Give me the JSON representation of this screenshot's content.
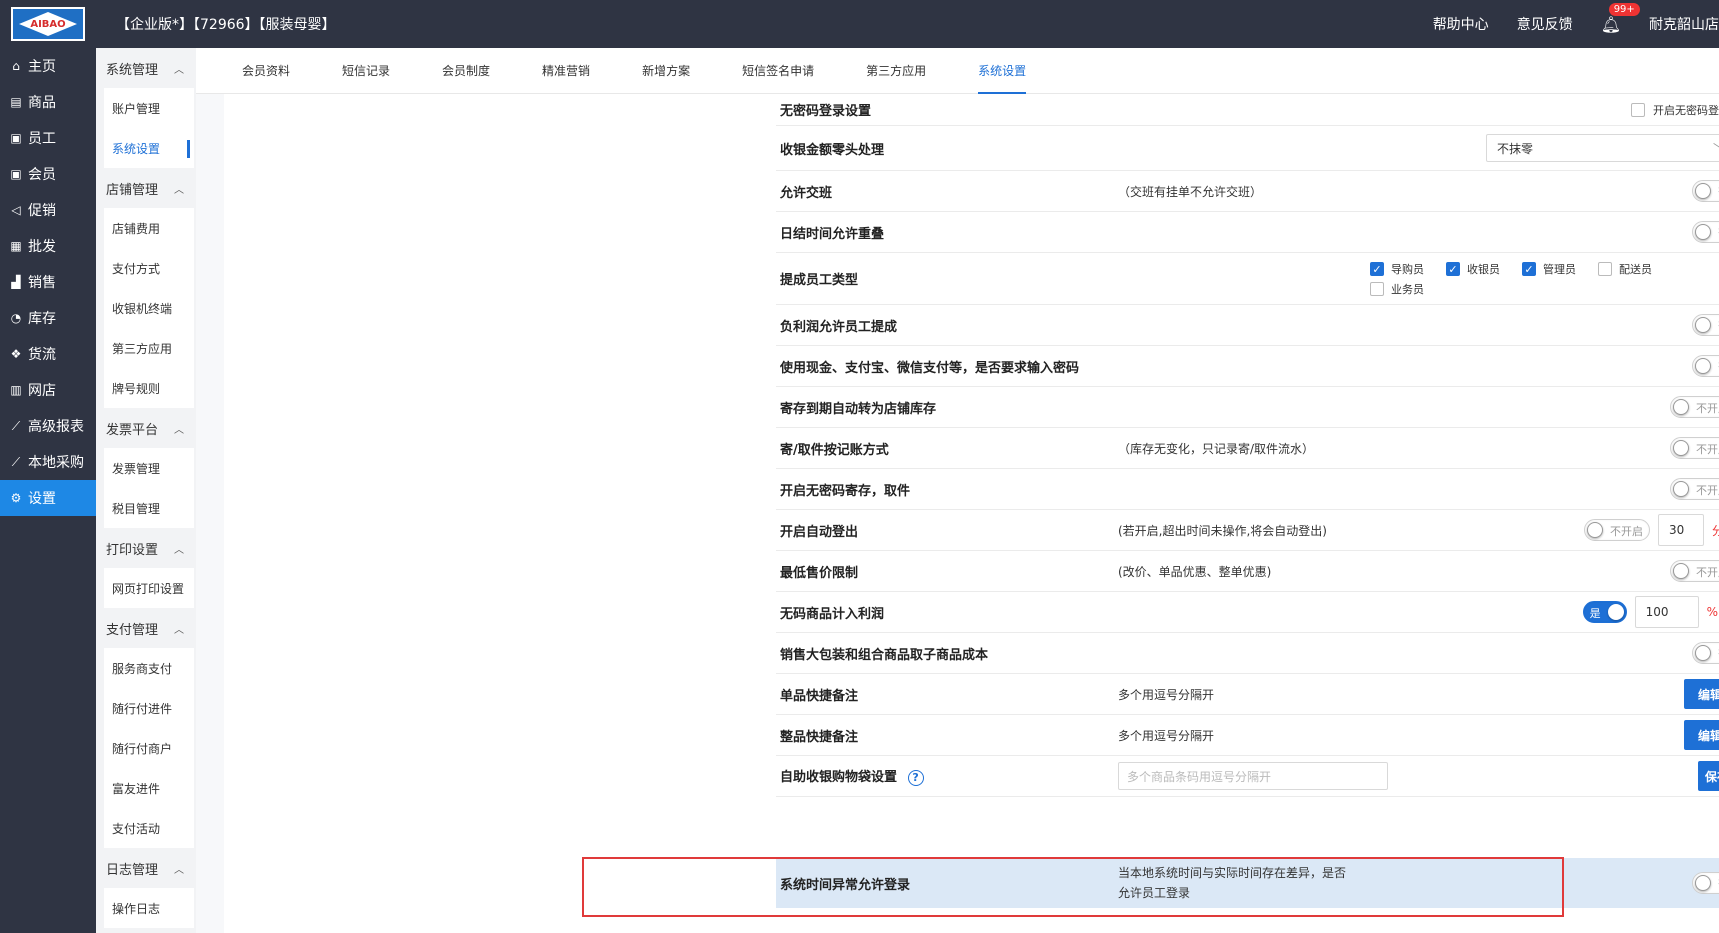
{
  "header": {
    "logo_text": "AIBAO",
    "edition": "【企业版*】【72966】【服装母婴】",
    "help_center": "帮助中心",
    "feedback": "意见反馈",
    "notification_badge": "99+",
    "store_name": "耐克韶山店"
  },
  "leftnav": [
    {
      "label": "主页",
      "icon": "home-icon",
      "glyph": "⌂"
    },
    {
      "label": "商品",
      "icon": "goods-icon",
      "glyph": "▤"
    },
    {
      "label": "员工",
      "icon": "staff-icon",
      "glyph": "▣"
    },
    {
      "label": "会员",
      "icon": "member-icon",
      "glyph": "▣"
    },
    {
      "label": "促销",
      "icon": "promotion-icon",
      "glyph": "◁"
    },
    {
      "label": "批发",
      "icon": "wholesale-icon",
      "glyph": "▦"
    },
    {
      "label": "销售",
      "icon": "sales-icon",
      "glyph": "▟"
    },
    {
      "label": "库存",
      "icon": "inventory-icon",
      "glyph": "◔"
    },
    {
      "label": "货流",
      "icon": "logistics-icon",
      "glyph": "❖"
    },
    {
      "label": "网店",
      "icon": "eshop-icon",
      "glyph": "▥"
    },
    {
      "label": "高级报表",
      "icon": "report-icon",
      "glyph": "⟋"
    },
    {
      "label": "本地采购",
      "icon": "purchase-icon",
      "glyph": "⟋"
    },
    {
      "label": "设置",
      "icon": "settings-icon",
      "glyph": "⚙"
    }
  ],
  "subnav": {
    "groups": [
      {
        "title": "系统管理",
        "items": [
          "账户管理",
          "系统设置"
        ]
      },
      {
        "title": "店铺管理",
        "items": [
          "店铺费用",
          "支付方式",
          "收银机终端",
          "第三方应用",
          "牌号规则"
        ]
      },
      {
        "title": "发票平台",
        "items": [
          "发票管理",
          "税目管理"
        ]
      },
      {
        "title": "打印设置",
        "items": [
          "网页打印设置"
        ]
      },
      {
        "title": "支付管理",
        "items": [
          "服务商支付",
          "随行付进件",
          "随行付商户",
          "富友进件",
          "支付活动"
        ]
      },
      {
        "title": "日志管理",
        "items": [
          "操作日志"
        ]
      }
    ],
    "active_item": "系统设置"
  },
  "tabs": [
    "会员资料",
    "短信记录",
    "会员制度",
    "精准营销",
    "新增方案",
    "短信签名申请",
    "第三方应用",
    "系统设置"
  ],
  "active_tab": "系统设置",
  "settings": {
    "no_password_login": {
      "label": "无密码登录设置",
      "checkbox_label": "开启无密码登陆"
    },
    "rounding": {
      "label": "收银金额零头处理",
      "value": "不抹零"
    },
    "allow_shift": {
      "label": "允许交班",
      "desc": "（交班有挂单不允许交班）",
      "switch": "否"
    },
    "daily_overlap": {
      "label": "日结时间允许重叠",
      "switch": "否"
    },
    "commission_types": {
      "label": "提成员工类型",
      "options": [
        "导购员",
        "收银员",
        "管理员",
        "配送员",
        "业务员"
      ]
    },
    "negative_profit": {
      "label": "负利润允许员工提成",
      "switch": "否"
    },
    "payment_password": {
      "label": "使用现金、支付宝、微信支付等，是否要求输入密码",
      "switch": "否"
    },
    "deposit_expire": {
      "label": "寄存到期自动转为店铺库存",
      "switch": "不开启"
    },
    "deposit_method": {
      "label": "寄/取件按记账方式",
      "desc": "（库存无变化，只记录寄/取件流水）",
      "switch": "不开启"
    },
    "no_code_deposit": {
      "label": "开启无密码寄存，取件",
      "switch": "不开启"
    },
    "auto_logout": {
      "label": "开启自动登出",
      "desc": "(若开启,超出时间未操作,将会自动登出)",
      "switch": "不开启",
      "minutes": "30",
      "unit": "分钟"
    },
    "min_price": {
      "label": "最低售价限制",
      "desc": "(改价、单品优惠、整单优惠)",
      "switch": "不开启"
    },
    "no_code_profit": {
      "label": "无码商品计入利润",
      "switch": "是",
      "percent": "100",
      "unit": "%"
    },
    "bundle_cost": {
      "label": "销售大包装和组合商品取子商品成本",
      "switch": "否"
    },
    "item_note": {
      "label": "单品快捷备注",
      "desc": "多个用逗号分隔开",
      "button": "编辑"
    },
    "order_note": {
      "label": "整品快捷备注",
      "desc": "多个用逗号分隔开",
      "button": "编辑"
    },
    "bag_setting": {
      "label": "自助收银购物袋设置",
      "placeholder": "多个商品条码用逗号分隔开",
      "button": "保存"
    },
    "time_anomaly": {
      "label": "系统时间异常允许登录",
      "desc_line1": "当本地系统时间与实际时间存在差异，是否",
      "desc_line2": "允许员工登录",
      "switch": "否"
    }
  }
}
